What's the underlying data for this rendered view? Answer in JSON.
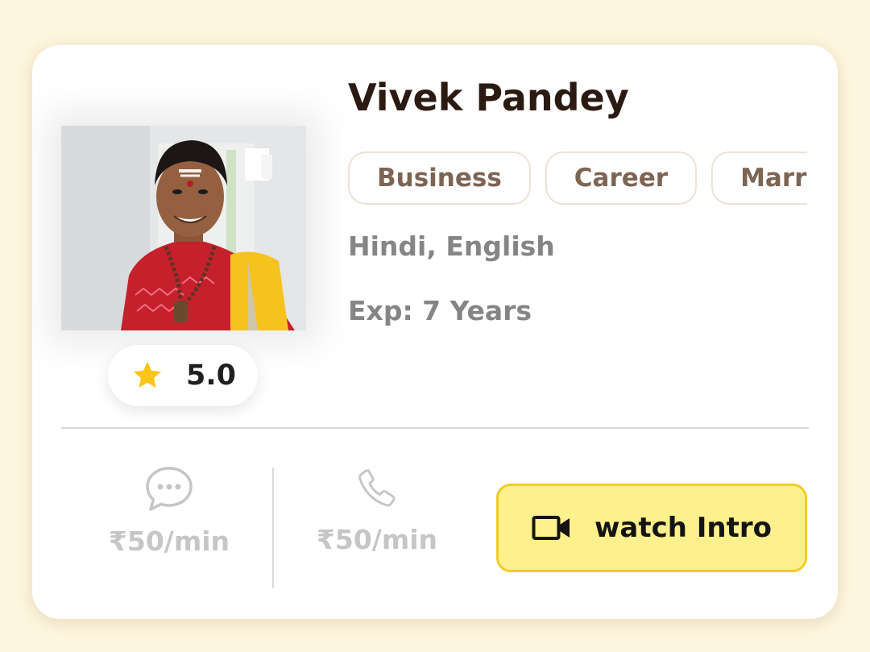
{
  "profile": {
    "name": "Vivek Pandey",
    "rating": "5.0",
    "tags": [
      "Business",
      "Career",
      "Marriage"
    ],
    "languages": "Hindi, English",
    "experience": "Exp: 7 Years"
  },
  "pricing": {
    "chat_price": "₹50/min",
    "call_price": "₹50/min"
  },
  "actions": {
    "watch_intro_label": "watch Intro"
  },
  "icons": {
    "star": "star-icon",
    "chat": "chat-bubble-icon",
    "call": "phone-icon",
    "video": "video-camera-icon"
  },
  "colors": {
    "page_background": "#fdf5dd",
    "card_background": "#ffffff",
    "name_text": "#2b1a12",
    "tag_text": "#7d6453",
    "tag_border": "#ece2d6",
    "meta_text": "#858585",
    "price_text": "#c6c6c6",
    "star": "#fcc419",
    "button_fill": "#fff08e",
    "button_border": "#f1cc27"
  }
}
